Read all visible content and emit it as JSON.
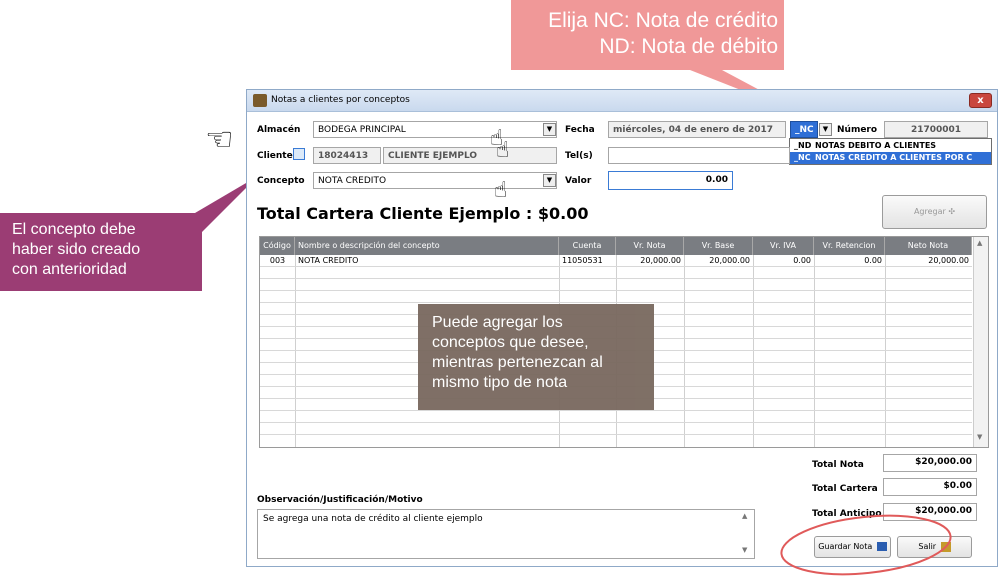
{
  "callouts": {
    "top_line1": "Elija NC: Nota de crédito",
    "top_line2": "ND: Nota de débito",
    "left_line1": "El concepto debe",
    "left_line2": "haber sido creado",
    "left_line3": "con anterioridad",
    "mid_line1": "Puede agregar los",
    "mid_line2": "conceptos que desee,",
    "mid_line3": "mientras pertenezcan al",
    "mid_line4": "mismo tipo de nota"
  },
  "window": {
    "title": "Notas a clientes por conceptos",
    "close": "x"
  },
  "form": {
    "almacen_label": "Almacén",
    "almacen_value": "BODEGA PRINCIPAL",
    "fecha_label": "Fecha",
    "fecha_value": "miércoles, 04 de enero de 2017",
    "tipo_value": "_NC",
    "numero_label": "Número",
    "numero_value": "21700001",
    "cliente_label": "Cliente",
    "cliente_codigo": "18024413",
    "cliente_nombre": "CLIENTE EJEMPLO",
    "tels_label": "Tel(s)",
    "tels_value": "",
    "concepto_label": "Concepto",
    "concepto_value": "NOTA CREDITO",
    "valor_label": "Valor",
    "valor_value": "0.00"
  },
  "dropdown_options": [
    {
      "code": "_ND",
      "label": "NOTAS DEBITO A CLIENTES"
    },
    {
      "code": "_NC",
      "label": "NOTAS CREDITO A CLIENTES POR C"
    }
  ],
  "total_cartera_heading": "Total Cartera Cliente Ejemplo : $0.00",
  "agregar_label": "Agregar ✣",
  "grid": {
    "headers": [
      "Código",
      "Nombre o descripción del concepto",
      "Cuenta",
      "Vr. Nota",
      "Vr. Base",
      "Vr. IVA",
      "Vr. Retencion",
      "Neto Nota"
    ],
    "rows": [
      [
        "003",
        "NOTA CREDITO",
        "11050531",
        "20,000.00",
        "20,000.00",
        "0.00",
        "0.00",
        "20,000.00"
      ]
    ]
  },
  "totals": {
    "total_nota_label": "Total Nota",
    "total_nota_value": "$20,000.00",
    "total_cartera_label": "Total Cartera",
    "total_cartera_value": "$0.00",
    "total_anticipo_label": "Total Anticipo",
    "total_anticipo_value": "$20,000.00"
  },
  "observacion": {
    "label": "Observación/Justificación/Motivo",
    "value": "Se agrega una nota de crédito al cliente ejemplo"
  },
  "buttons": {
    "guardar": "Guardar Nota",
    "salir": "Salir"
  },
  "colors": {
    "callout_top": "#f09898",
    "callout_left": "#9b3d74",
    "callout_mid": "#7a6a60",
    "grid_header": "#7a7d82"
  }
}
